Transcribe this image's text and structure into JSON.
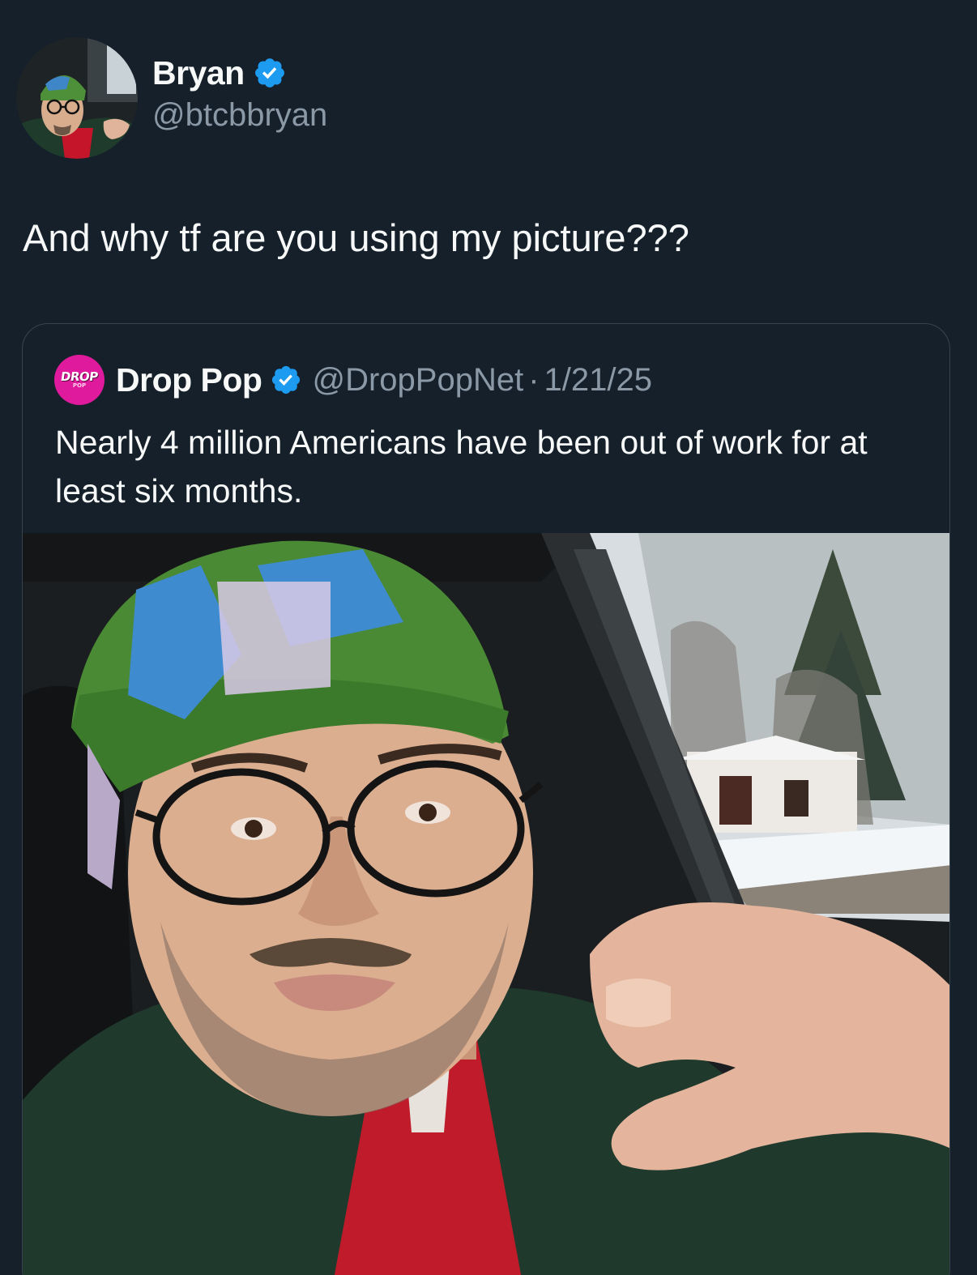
{
  "tweet": {
    "author_name": "Bryan",
    "author_handle": "@btcbbryan",
    "text": "And why tf are you using my picture???"
  },
  "quoted_tweet": {
    "avatar_text": "DROP",
    "avatar_subtext": "POP",
    "author_name": "Drop Pop",
    "author_handle": "@DropPopNet",
    "separator": "·",
    "date": "1/21/25",
    "text": "Nearly 4 million Americans have been out of work for at least six months."
  },
  "icons": {
    "verified": "verified-badge-icon"
  },
  "colors": {
    "background": "#15202b",
    "text_primary": "#f7f9f9",
    "text_secondary": "#8b98a5",
    "verified_blue": "#1d9bf0",
    "border": "#38444d",
    "drop_pop_pink": "#e01a9c"
  }
}
